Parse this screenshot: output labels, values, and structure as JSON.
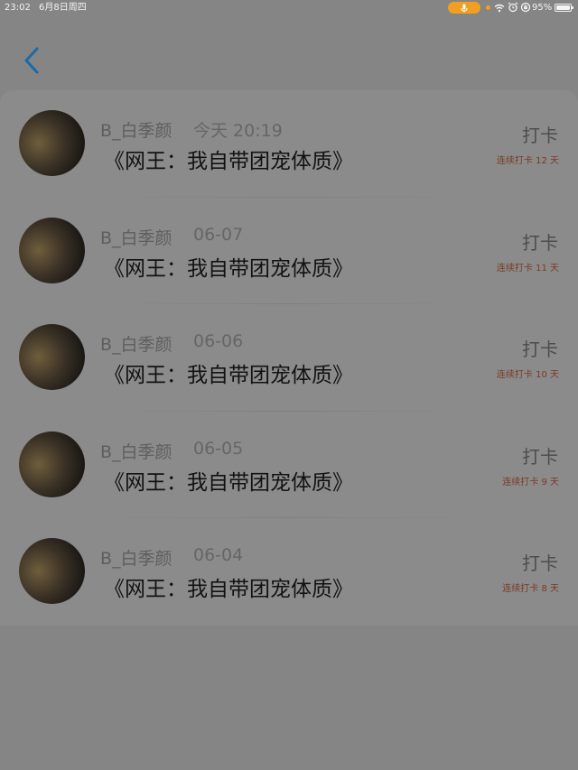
{
  "status_bar": {
    "time": "23:02",
    "date": "6月8日周四",
    "battery": "95%",
    "accent_color": "#f0a020"
  },
  "nav": {
    "back_icon": "chevron-left-icon",
    "accent_color": "#1a6aa8"
  },
  "items": [
    {
      "user": "B_白季颜",
      "time": "今天 20:19",
      "title": "《网王：我自带团宠体质》",
      "action": "打卡",
      "streak": "连续打卡 12 天"
    },
    {
      "user": "B_白季颜",
      "time": "06-07",
      "title": "《网王：我自带团宠体质》",
      "action": "打卡",
      "streak": "连续打卡 11 天"
    },
    {
      "user": "B_白季颜",
      "time": "06-06",
      "title": "《网王：我自带团宠体质》",
      "action": "打卡",
      "streak": "连续打卡 10 天"
    },
    {
      "user": "B_白季颜",
      "time": "06-05",
      "title": "《网王：我自带团宠体质》",
      "action": "打卡",
      "streak": "连续打卡 9 天"
    },
    {
      "user": "B_白季颜",
      "time": "06-04",
      "title": "《网王：我自带团宠体质》",
      "action": "打卡",
      "streak": "连续打卡 8 天"
    }
  ]
}
